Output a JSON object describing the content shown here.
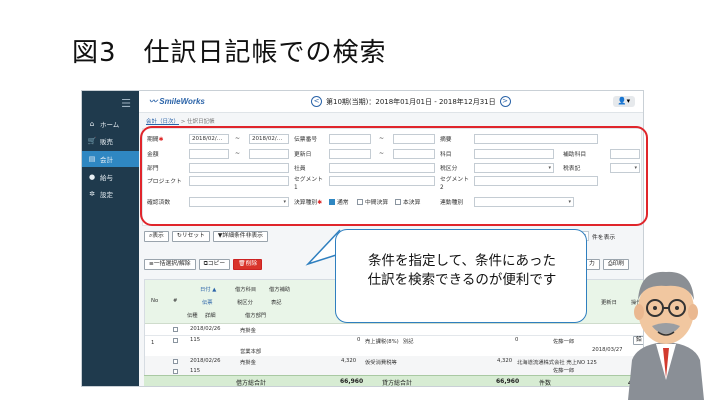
{
  "slide": {
    "title": "図3　仕訳日記帳での検索"
  },
  "sidebar": {
    "items": [
      {
        "label": "ホーム",
        "icon": "home-icon"
      },
      {
        "label": "販売",
        "icon": "cart-icon"
      },
      {
        "label": "会計",
        "icon": "ledger-icon"
      },
      {
        "label": "給与",
        "icon": "money-icon"
      },
      {
        "label": "設定",
        "icon": "gear-icon"
      }
    ],
    "active": "会計"
  },
  "topbar": {
    "logo": "SmileWorks",
    "period": "第10期(当期)：2018年01月01日 - 2018年12月31日",
    "prev": "<",
    "next": ">"
  },
  "breadcrumb": {
    "link": "会計（日次）",
    "rest": " > 仕訳日記帳"
  },
  "form": {
    "period_label": "期間",
    "period_from": "2018/02/…",
    "period_to": "2018/02/…",
    "denpyo_label": "伝票番号",
    "tekiyo_label": "摘要",
    "kingaku_label": "金額",
    "koshin_label": "更新日",
    "kamoku_label": "科目",
    "hojo_label": "補助科目",
    "bumon_label": "部門",
    "shain_label": "社員",
    "zeikubun_label": "税区分",
    "zeihyoki_label": "税表記",
    "project_label": "プロジェクト",
    "segment1_label": "セグメント1",
    "segment2_label": "セグメント2",
    "kakunin_label": "確認済数",
    "kessan_label": "決算種別",
    "kessan_opts": [
      "通常",
      "中間決算",
      "本決算"
    ],
    "renkei_label": "連動種別",
    "tilde": "~"
  },
  "toolbar": {
    "display": "表示",
    "reset": "リセット",
    "detail": "詳細条件非表示",
    "page_suffix": "件を表示",
    "bulk": "一括選択/解除",
    "copy": "コピー",
    "delete": "削除",
    "print": "印刷",
    "output": "力"
  },
  "table": {
    "headers": {
      "no": "No",
      "hash": "#",
      "date": "日付 ▲",
      "debit_acct": "借方科目",
      "debit_sub": "借方補助",
      "debit_amt": "借方金額",
      "credit_dept": "借方部門",
      "denpyo": "伝票",
      "tax_cat": "税区分",
      "tax_disp": "表記",
      "bunrui": "伝種",
      "shoshiki": "詳細",
      "date_r": "更新日",
      "op": "操作"
    },
    "rows": [
      {
        "no": "1",
        "date": "2018/02/26",
        "acct": "売掛金",
        "num": "115",
        "amount": "0",
        "desc": "売上課税(8%)",
        "flag": "別記",
        "credit_amt": "0",
        "staff": "佐藤一郎",
        "dept": "営業本部",
        "updated": "2018/03/27"
      },
      {
        "date": "2018/02/26",
        "acct": "売掛金",
        "num": "115",
        "amount": "4,320",
        "desc": "仮受消費税等",
        "credit_amt": "4,320",
        "partner": "北海道流通株式会社 売上NO 125",
        "staff": "佐藤一郎"
      }
    ]
  },
  "totals": {
    "debit_label": "借方総合計",
    "debit_value": "66,960",
    "credit_label": "貸方総合計",
    "credit_value": "66,960",
    "count_label": "件数",
    "count_value": "4件"
  },
  "callout": {
    "line1": "条件を指定して、条件にあった",
    "line2": "仕訳を検索できるのが便利です"
  },
  "colors": {
    "accent": "#2f87c2",
    "highlight_frame": "#e0252b",
    "sidebar": "#1f3a4d"
  }
}
